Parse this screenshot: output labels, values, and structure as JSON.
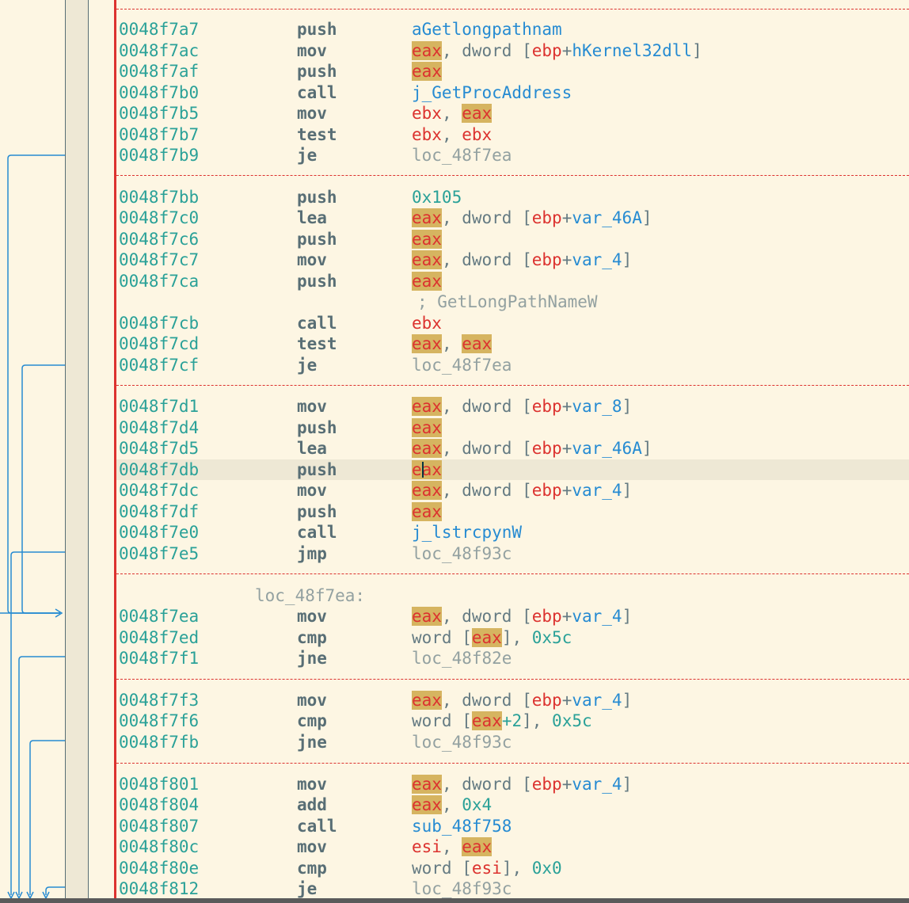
{
  "listing": {
    "lines": [
      {
        "address": "0048f7a7",
        "mnemonic": "push",
        "operands": [
          {
            "t": "aGetlongpathnam",
            "k": "sym"
          }
        ]
      },
      {
        "address": "0048f7ac",
        "mnemonic": "mov",
        "operands": [
          {
            "t": "eax",
            "k": "hl"
          },
          {
            "t": ", ",
            "k": "punc"
          },
          {
            "t": "dword",
            "k": "kw"
          },
          {
            "t": " [",
            "k": "punc"
          },
          {
            "t": "ebp",
            "k": "reg"
          },
          {
            "t": "+",
            "k": "punc"
          },
          {
            "t": "hKernel32dll",
            "k": "sym"
          },
          {
            "t": "]",
            "k": "punc"
          }
        ]
      },
      {
        "address": "0048f7af",
        "mnemonic": "push",
        "operands": [
          {
            "t": "eax",
            "k": "hl"
          }
        ]
      },
      {
        "address": "0048f7b0",
        "mnemonic": "call",
        "operands": [
          {
            "t": "j_GetProcAddress",
            "k": "sym"
          }
        ]
      },
      {
        "address": "0048f7b5",
        "mnemonic": "mov",
        "operands": [
          {
            "t": "ebx",
            "k": "reg"
          },
          {
            "t": ", ",
            "k": "punc"
          },
          {
            "t": "eax",
            "k": "hl"
          }
        ]
      },
      {
        "address": "0048f7b7",
        "mnemonic": "test",
        "operands": [
          {
            "t": "ebx",
            "k": "reg"
          },
          {
            "t": ", ",
            "k": "punc"
          },
          {
            "t": "ebx",
            "k": "reg"
          }
        ]
      },
      {
        "address": "0048f7b9",
        "mnemonic": "je",
        "operands": [
          {
            "t": "loc_48f7ea",
            "k": "loc"
          }
        ]
      },
      {
        "address": "0048f7bb",
        "mnemonic": "push",
        "operands": [
          {
            "t": "0x105",
            "k": "num"
          }
        ]
      },
      {
        "address": "0048f7c0",
        "mnemonic": "lea",
        "operands": [
          {
            "t": "eax",
            "k": "hl"
          },
          {
            "t": ", ",
            "k": "punc"
          },
          {
            "t": "dword",
            "k": "kw"
          },
          {
            "t": " [",
            "k": "punc"
          },
          {
            "t": "ebp",
            "k": "reg"
          },
          {
            "t": "+",
            "k": "punc"
          },
          {
            "t": "var_46A",
            "k": "sym"
          },
          {
            "t": "]",
            "k": "punc"
          }
        ]
      },
      {
        "address": "0048f7c6",
        "mnemonic": "push",
        "operands": [
          {
            "t": "eax",
            "k": "hl"
          }
        ]
      },
      {
        "address": "0048f7c7",
        "mnemonic": "mov",
        "operands": [
          {
            "t": "eax",
            "k": "hl"
          },
          {
            "t": ", ",
            "k": "punc"
          },
          {
            "t": "dword",
            "k": "kw"
          },
          {
            "t": " [",
            "k": "punc"
          },
          {
            "t": "ebp",
            "k": "reg"
          },
          {
            "t": "+",
            "k": "punc"
          },
          {
            "t": "var_4",
            "k": "sym"
          },
          {
            "t": "]",
            "k": "punc"
          }
        ]
      },
      {
        "address": "0048f7ca",
        "mnemonic": "push",
        "operands": [
          {
            "t": "eax",
            "k": "hl"
          }
        ]
      },
      {
        "comment": "; GetLongPathNameW"
      },
      {
        "address": "0048f7cb",
        "mnemonic": "call",
        "operands": [
          {
            "t": "ebx",
            "k": "reg"
          }
        ]
      },
      {
        "address": "0048f7cd",
        "mnemonic": "test",
        "operands": [
          {
            "t": "eax",
            "k": "hl"
          },
          {
            "t": ", ",
            "k": "punc"
          },
          {
            "t": "eax",
            "k": "hl"
          }
        ]
      },
      {
        "address": "0048f7cf",
        "mnemonic": "je",
        "operands": [
          {
            "t": "loc_48f7ea",
            "k": "loc"
          }
        ]
      },
      {
        "address": "0048f7d1",
        "mnemonic": "mov",
        "operands": [
          {
            "t": "eax",
            "k": "hl"
          },
          {
            "t": ", ",
            "k": "punc"
          },
          {
            "t": "dword",
            "k": "kw"
          },
          {
            "t": " [",
            "k": "punc"
          },
          {
            "t": "ebp",
            "k": "reg"
          },
          {
            "t": "+",
            "k": "punc"
          },
          {
            "t": "var_8",
            "k": "sym"
          },
          {
            "t": "]",
            "k": "punc"
          }
        ]
      },
      {
        "address": "0048f7d4",
        "mnemonic": "push",
        "operands": [
          {
            "t": "eax",
            "k": "hl"
          }
        ]
      },
      {
        "address": "0048f7d5",
        "mnemonic": "lea",
        "operands": [
          {
            "t": "eax",
            "k": "hl"
          },
          {
            "t": ", ",
            "k": "punc"
          },
          {
            "t": "dword",
            "k": "kw"
          },
          {
            "t": " [",
            "k": "punc"
          },
          {
            "t": "ebp",
            "k": "reg"
          },
          {
            "t": "+",
            "k": "punc"
          },
          {
            "t": "var_46A",
            "k": "sym"
          },
          {
            "t": "]",
            "k": "punc"
          }
        ]
      },
      {
        "address": "0048f7db",
        "mnemonic": "push",
        "operands": [
          {
            "t": "eax",
            "k": "hl"
          }
        ],
        "current": true
      },
      {
        "address": "0048f7dc",
        "mnemonic": "mov",
        "operands": [
          {
            "t": "eax",
            "k": "hl"
          },
          {
            "t": ", ",
            "k": "punc"
          },
          {
            "t": "dword",
            "k": "kw"
          },
          {
            "t": " [",
            "k": "punc"
          },
          {
            "t": "ebp",
            "k": "reg"
          },
          {
            "t": "+",
            "k": "punc"
          },
          {
            "t": "var_4",
            "k": "sym"
          },
          {
            "t": "]",
            "k": "punc"
          }
        ]
      },
      {
        "address": "0048f7df",
        "mnemonic": "push",
        "operands": [
          {
            "t": "eax",
            "k": "hl"
          }
        ]
      },
      {
        "address": "0048f7e0",
        "mnemonic": "call",
        "operands": [
          {
            "t": "j_lstrcpynW",
            "k": "sym"
          }
        ]
      },
      {
        "address": "0048f7e5",
        "mnemonic": "jmp",
        "operands": [
          {
            "t": "loc_48f93c",
            "k": "loc"
          }
        ]
      },
      {
        "label": "loc_48f7ea:"
      },
      {
        "address": "0048f7ea",
        "mnemonic": "mov",
        "operands": [
          {
            "t": "eax",
            "k": "hl"
          },
          {
            "t": ", ",
            "k": "punc"
          },
          {
            "t": "dword",
            "k": "kw"
          },
          {
            "t": " [",
            "k": "punc"
          },
          {
            "t": "ebp",
            "k": "reg"
          },
          {
            "t": "+",
            "k": "punc"
          },
          {
            "t": "var_4",
            "k": "sym"
          },
          {
            "t": "]",
            "k": "punc"
          }
        ]
      },
      {
        "address": "0048f7ed",
        "mnemonic": "cmp",
        "operands": [
          {
            "t": "word",
            "k": "kw"
          },
          {
            "t": " [",
            "k": "punc"
          },
          {
            "t": "eax",
            "k": "hl"
          },
          {
            "t": "], ",
            "k": "punc"
          },
          {
            "t": "0x5c",
            "k": "num"
          }
        ]
      },
      {
        "address": "0048f7f1",
        "mnemonic": "jne",
        "operands": [
          {
            "t": "loc_48f82e",
            "k": "loc"
          }
        ]
      },
      {
        "address": "0048f7f3",
        "mnemonic": "mov",
        "operands": [
          {
            "t": "eax",
            "k": "hl"
          },
          {
            "t": ", ",
            "k": "punc"
          },
          {
            "t": "dword",
            "k": "kw"
          },
          {
            "t": " [",
            "k": "punc"
          },
          {
            "t": "ebp",
            "k": "reg"
          },
          {
            "t": "+",
            "k": "punc"
          },
          {
            "t": "var_4",
            "k": "sym"
          },
          {
            "t": "]",
            "k": "punc"
          }
        ]
      },
      {
        "address": "0048f7f6",
        "mnemonic": "cmp",
        "operands": [
          {
            "t": "word",
            "k": "kw"
          },
          {
            "t": " [",
            "k": "punc"
          },
          {
            "t": "eax",
            "k": "hl"
          },
          {
            "t": "+2",
            "k": "num"
          },
          {
            "t": "], ",
            "k": "punc"
          },
          {
            "t": "0x5c",
            "k": "num"
          }
        ]
      },
      {
        "address": "0048f7fb",
        "mnemonic": "jne",
        "operands": [
          {
            "t": "loc_48f93c",
            "k": "loc"
          }
        ]
      },
      {
        "address": "0048f801",
        "mnemonic": "mov",
        "operands": [
          {
            "t": "eax",
            "k": "hl"
          },
          {
            "t": ", ",
            "k": "punc"
          },
          {
            "t": "dword",
            "k": "kw"
          },
          {
            "t": " [",
            "k": "punc"
          },
          {
            "t": "ebp",
            "k": "reg"
          },
          {
            "t": "+",
            "k": "punc"
          },
          {
            "t": "var_4",
            "k": "sym"
          },
          {
            "t": "]",
            "k": "punc"
          }
        ]
      },
      {
        "address": "0048f804",
        "mnemonic": "add",
        "operands": [
          {
            "t": "eax",
            "k": "hl"
          },
          {
            "t": ", ",
            "k": "punc"
          },
          {
            "t": "0x4",
            "k": "num"
          }
        ]
      },
      {
        "address": "0048f807",
        "mnemonic": "call",
        "operands": [
          {
            "t": "sub_48f758",
            "k": "sym"
          }
        ]
      },
      {
        "address": "0048f80c",
        "mnemonic": "mov",
        "operands": [
          {
            "t": "esi",
            "k": "reg"
          },
          {
            "t": ", ",
            "k": "punc"
          },
          {
            "t": "eax",
            "k": "hl"
          }
        ]
      },
      {
        "address": "0048f80e",
        "mnemonic": "cmp",
        "operands": [
          {
            "t": "word",
            "k": "kw"
          },
          {
            "t": " [",
            "k": "punc"
          },
          {
            "t": "esi",
            "k": "reg"
          },
          {
            "t": "], ",
            "k": "punc"
          },
          {
            "t": "0x0",
            "k": "num"
          }
        ]
      },
      {
        "address": "0048f812",
        "mnemonic": "je",
        "operands": [
          {
            "t": "loc_48f93c",
            "k": "loc"
          }
        ]
      }
    ]
  },
  "colors": {
    "background": "#fdf6e3",
    "gutter": "#eee8d5",
    "current_line": "#eee8d5",
    "separator": "#dc322f",
    "address": "#2aa198",
    "register": "#dc322f",
    "register_highlight_bg": "#d6b460",
    "symbol": "#268bd2",
    "number": "#2aa198",
    "mnemonic": "#586e75",
    "location": "#93a1a1",
    "flow_arrow": "#268bd2"
  }
}
